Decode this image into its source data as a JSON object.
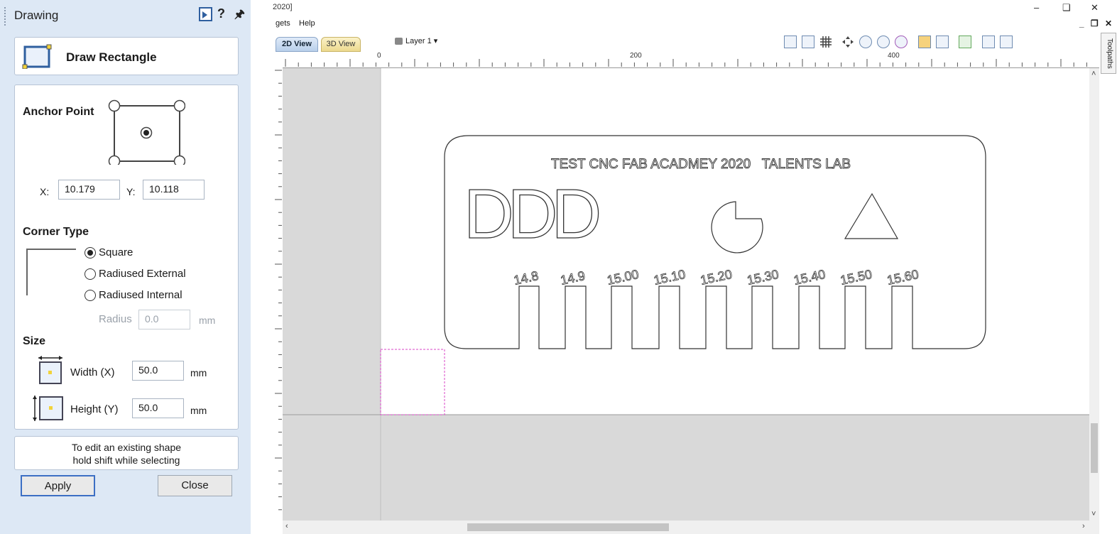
{
  "panel": {
    "title": "Drawing",
    "tool_title": "Draw Rectangle",
    "anchor_label": "Anchor Point",
    "x_label": "X:",
    "x_value": "10.179",
    "y_label": "Y:",
    "y_value": "10.118",
    "corner_label": "Corner Type",
    "corner_options": [
      "Square",
      "Radiused External",
      "Radiused Internal"
    ],
    "corner_selected": "Square",
    "radius_label": "Radius",
    "radius_value": "0.0",
    "radius_unit": "mm",
    "size_label": "Size",
    "width_label": "Width (X)",
    "width_value": "50.0",
    "width_unit": "mm",
    "height_label": "Height (Y)",
    "height_value": "50.0",
    "height_unit": "mm",
    "hint_line1": "To edit an existing shape",
    "hint_line2": "hold shift while selecting",
    "apply_label": "Apply",
    "close_label": "Close",
    "help_glyph": "?",
    "pin_glyph": "↑"
  },
  "app": {
    "title_fragment": "2020]",
    "menu": [
      "gets",
      "Help"
    ],
    "tabs": [
      "2D View",
      "3D View"
    ],
    "layer": "Layer 1 ▾",
    "side_tab": "Toolpaths",
    "ruler_labels": [
      "0",
      "200",
      "400"
    ],
    "window_controls": [
      "–",
      "❑",
      "✕"
    ],
    "mdi_controls": "_ ❐ ✕"
  },
  "design": {
    "title_text": "TEST CNC FAB ACADMEY 2020   TALENTS LAB",
    "letters": "DDD",
    "slot_labels": [
      "14.8",
      "14.9",
      "15.00",
      "15.10",
      "15.20",
      "15.30",
      "15.40",
      "15.50",
      "15.60"
    ]
  },
  "colors": {
    "panel_bg": "#dde8f5",
    "accent": "#2f5f9f",
    "selection": "#d946c7",
    "canvas_bg": "#d9d9d9"
  }
}
